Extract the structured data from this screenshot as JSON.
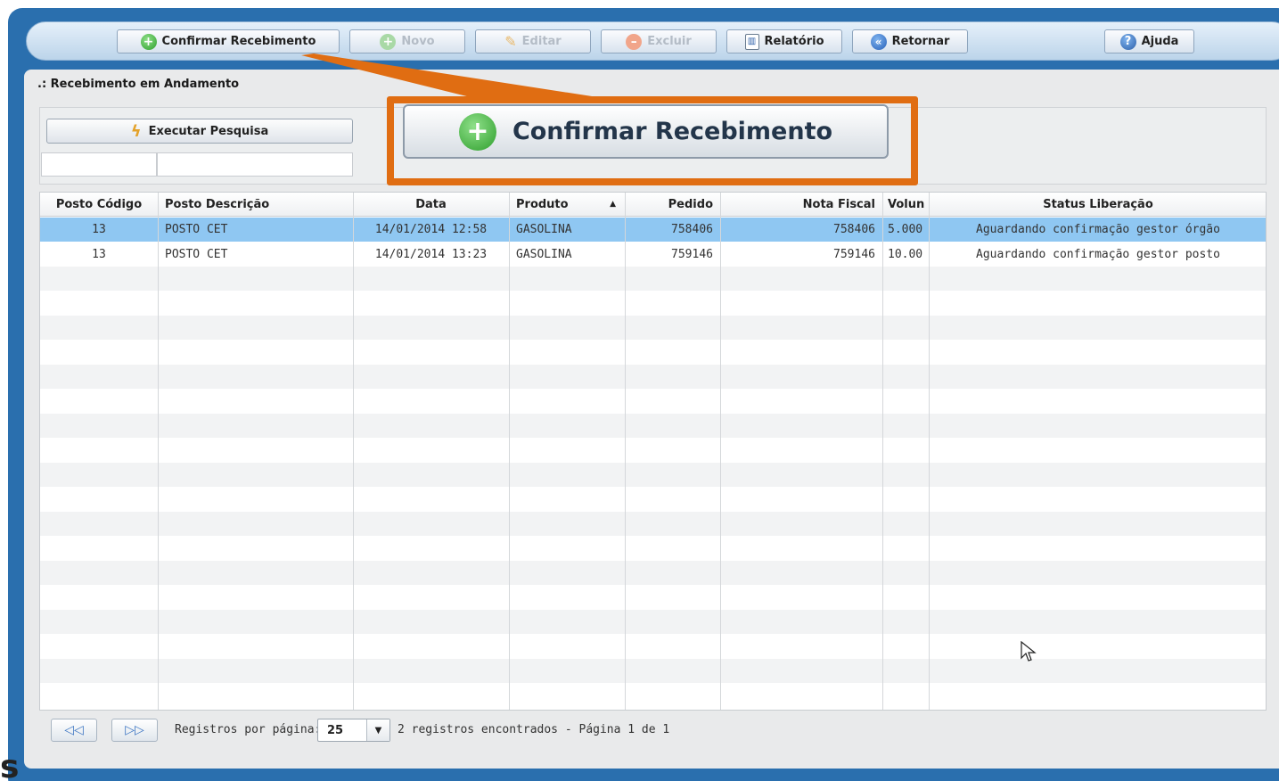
{
  "toolbar": {
    "buttons": [
      {
        "label": "Confirmar Recebimento",
        "icon": "plus-circle-icon",
        "enabled": true
      },
      {
        "label": "Novo",
        "icon": "plus-circle-icon",
        "enabled": false
      },
      {
        "label": "Editar",
        "icon": "pencil-icon",
        "enabled": false
      },
      {
        "label": "Excluir",
        "icon": "minus-circle-icon",
        "enabled": false
      },
      {
        "label": "Relatório",
        "icon": "report-icon",
        "enabled": true
      },
      {
        "label": "Retornar",
        "icon": "back-icon",
        "enabled": true
      }
    ],
    "help_label": "Ajuda"
  },
  "section_title": ".: Recebimento em Andamento",
  "search": {
    "execute_label": "Executar Pesquisa",
    "filter_code_value": "",
    "filter_desc_value": ""
  },
  "callout": {
    "label": "Confirmar Recebimento",
    "highlight_color": "#e06d12"
  },
  "grid": {
    "columns": [
      "Posto Código",
      "Posto Descrição",
      "Data",
      "Produto",
      "Pedido",
      "Nota Fiscal",
      "Volun",
      "Status Liberação"
    ],
    "sorted_column": "Produto",
    "sort_direction": "asc",
    "rows": [
      {
        "posto_codigo": "13",
        "posto_descricao": "POSTO CET",
        "data": "14/01/2014 12:58",
        "produto": "GASOLINA",
        "pedido": "758406",
        "nota_fiscal": "758406",
        "volume": "5.000",
        "status": "Aguardando confirmação gestor órgão",
        "selected": true
      },
      {
        "posto_codigo": "13",
        "posto_descricao": "POSTO CET",
        "data": "14/01/2014 13:23",
        "produto": "GASOLINA",
        "pedido": "759146",
        "nota_fiscal": "759146",
        "volume": "10.00",
        "status": "Aguardando confirmação gestor posto",
        "selected": false
      }
    ],
    "selected_color": "#8fc7f2"
  },
  "pager": {
    "per_page_label": "Registros por página:",
    "per_page_value": "25",
    "summary": "2 registros encontrados - Página 1 de 1"
  },
  "colors": {
    "frame": "#2a6fae",
    "panel": "#e9eaeb"
  }
}
